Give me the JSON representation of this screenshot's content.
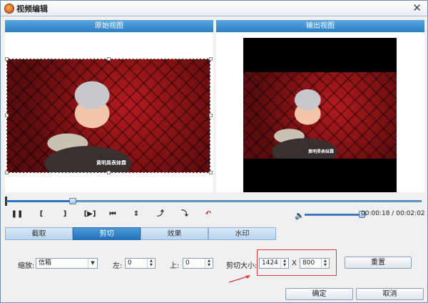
{
  "window": {
    "title": "视频编辑",
    "close_glyph": "✕"
  },
  "views": {
    "original_label": "原始视图",
    "output_label": "输出视图",
    "caption": "黄明昊表妹霖"
  },
  "controls": {
    "pause": "❚❚",
    "mark_in": "[",
    "mark_out": "]",
    "play_segment": "[▶]",
    "prev": "⏮",
    "flip_vertical": "⇕",
    "rotate_left": "⤴",
    "rotate_right": "⤵",
    "undo": "↶",
    "volume_icon": "speaker-icon"
  },
  "time": {
    "current": "00:00:18",
    "separator": "/",
    "total": "00:02:02"
  },
  "seek": {
    "progress": 0.16
  },
  "volume": {
    "level": 0.93
  },
  "tabs": [
    {
      "label": "截取",
      "active": false
    },
    {
      "label": "剪切",
      "active": true
    },
    {
      "label": "效果",
      "active": false
    },
    {
      "label": "水印",
      "active": false
    }
  ],
  "crop": {
    "zoom_label": "缩放:",
    "zoom_value": "信箱",
    "left_label": "左:",
    "left_value": "0",
    "top_label": "上:",
    "top_value": "0",
    "size_label": "剪切大小:",
    "width_value": "1424",
    "x_label": "X",
    "height_value": "800",
    "reset_label": "重置"
  },
  "footer": {
    "ok_label": "确定",
    "cancel_label": "取消"
  },
  "colors": {
    "accent": "#2c7fc4",
    "highlight_box": "#d73b3b"
  }
}
